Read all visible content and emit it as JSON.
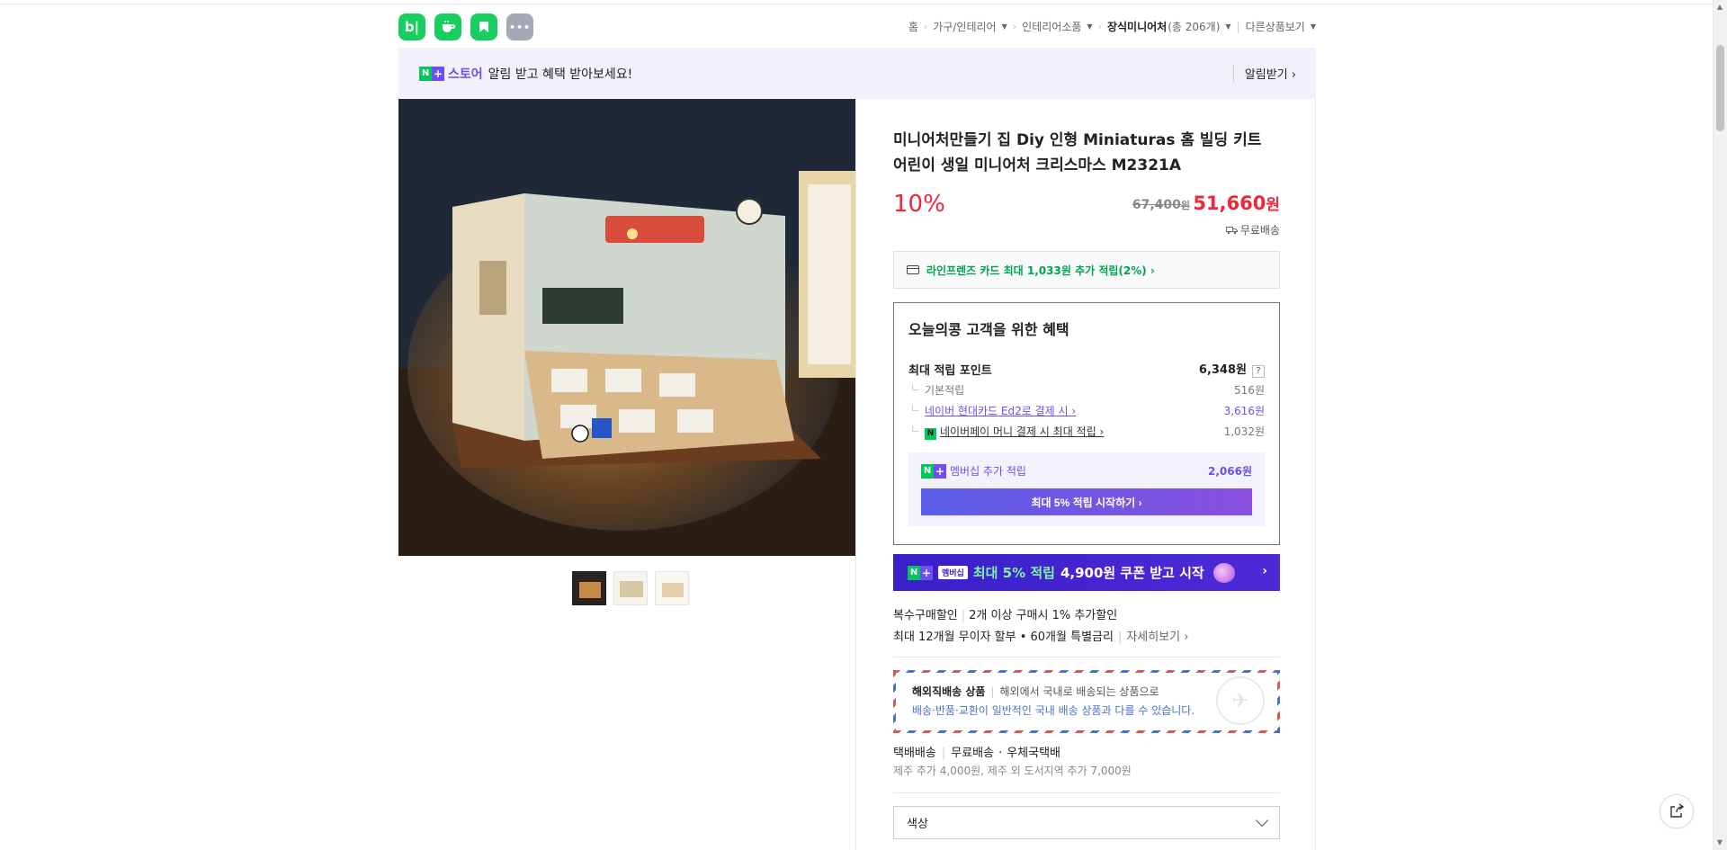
{
  "app_icons": [
    {
      "label": "b|",
      "name": "blog",
      "color": "#19ce60"
    },
    {
      "label": "",
      "name": "cafe",
      "color": "#19ce60"
    },
    {
      "label": "",
      "name": "bookmark",
      "color": "#19ce60"
    },
    {
      "label": "•••",
      "name": "more",
      "color": "#a4a9b8"
    }
  ],
  "breadcrumb": {
    "home": "홈",
    "cat1": "가구/인테리어",
    "cat2": "인테리어소품",
    "cat3": "장식미니어처",
    "cat3_count": "(총 206개)",
    "other": "다른상품보기"
  },
  "notice": {
    "badge_n": "N",
    "badge_plus": "+",
    "store": "스토어",
    "message": "알림 받고 혜택 받아보세요!",
    "alarm": "알림받기 ›"
  },
  "product": {
    "title": "미니어처만들기 집 Diy 인형 Miniaturas 홈 빌딩 키트 어린이 생일 미니어처 크리스마스 M2321A",
    "discount": "10%",
    "original_price": "67,400",
    "original_unit": "원",
    "sale_price": "51,660",
    "sale_unit": "원",
    "shipping": "무료배송"
  },
  "card_benefit": "라인프렌즈 카드 최대 1,033원 추가 적립(2%) ›",
  "benefit": {
    "title": "오늘의콩 고객을 위한 혜택",
    "max_points_label": "최대 적립 포인트",
    "max_points_value": "6,348원",
    "help": "?",
    "rows": [
      {
        "label": "기본적립",
        "value": "516원"
      },
      {
        "label": "네이버 현대카드 Ed2로 결제 시 ›",
        "value": "3,616원"
      },
      {
        "label": "네이버페이 머니 결제 시 최대 적립 ›",
        "value": "1,032원"
      }
    ],
    "npay_badge": "N",
    "member_label": "멤버십 추가 적립",
    "member_value": "2,066원",
    "start_button": "최대 5% 적립 시작하기 ›"
  },
  "promo": {
    "badge": "멤버십",
    "highlight": "최대 5% 적립",
    "text": "4,900원 쿠폰 받고 시작",
    "arrow": "›"
  },
  "multi_discount": {
    "label": "복수구매할인",
    "text": "2개 이상 구매시 1% 추가할인"
  },
  "installment": {
    "text": "최대 12개월 무이자 할부 • 60개월 특별금리",
    "more": "자세히보기 ›"
  },
  "overseas": {
    "title": "해외직배송 상품",
    "desc": "해외에서 국내로 배송되는 상품으로",
    "warning": "배송·반품·교환이 일반적인 국내 배송 상품과 다를 수 있습니다."
  },
  "delivery": {
    "type": "택배배송",
    "fee": "무료배송",
    "carrier": "우체국택배",
    "extra": "제주 추가 4,000원, 제주 외 도서지역 추가 7,000원"
  },
  "option_select": {
    "label": "색상"
  }
}
